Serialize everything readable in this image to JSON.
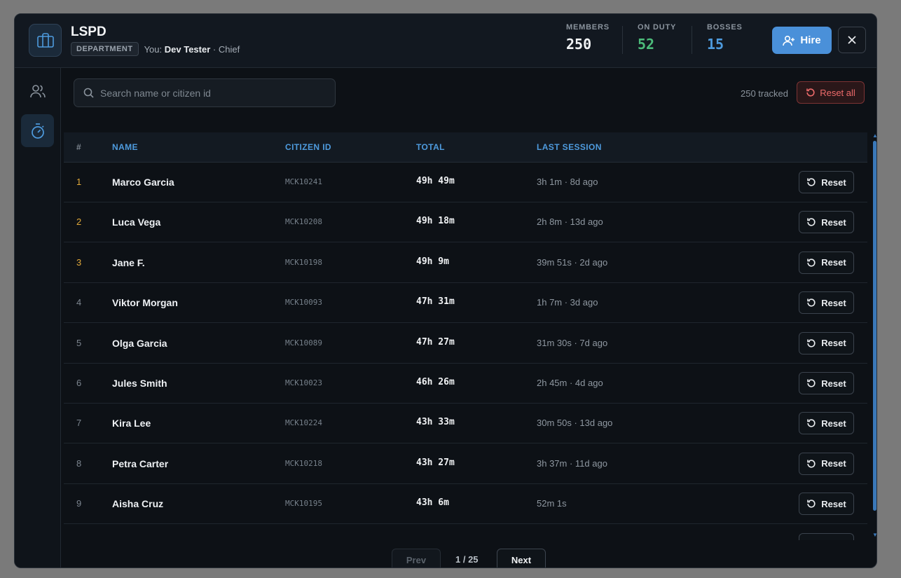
{
  "header": {
    "title": "LSPD",
    "badge": "DEPARTMENT",
    "you_prefix": "You:",
    "you_name": "Dev Tester",
    "you_role": "· Chief",
    "hire_label": "Hire"
  },
  "stats": {
    "members": {
      "label": "MEMBERS",
      "value": "250",
      "color": "#f1f3f5"
    },
    "on_duty": {
      "label": "ON DUTY",
      "value": "52",
      "color": "#4cbb7a"
    },
    "bosses": {
      "label": "BOSSES",
      "value": "15",
      "color": "#4e9bde"
    }
  },
  "sidebar": {
    "items": [
      {
        "icon": "users-icon",
        "active": false
      },
      {
        "icon": "stopwatch-icon",
        "active": true
      }
    ]
  },
  "toolbar": {
    "search_placeholder": "Search name or citizen id",
    "tracked": "250 tracked",
    "reset_all_label": "Reset all"
  },
  "table": {
    "columns": [
      "#",
      "NAME",
      "CITIZEN ID",
      "TOTAL",
      "LAST SESSION"
    ],
    "reset_label": "Reset",
    "rows": [
      {
        "rank": "1",
        "name": "Marco Garcia",
        "cid": "MCK10241",
        "total": "49h 49m",
        "last": "3h 1m · 8d ago"
      },
      {
        "rank": "2",
        "name": "Luca Vega",
        "cid": "MCK10208",
        "total": "49h 18m",
        "last": "2h 8m · 13d ago"
      },
      {
        "rank": "3",
        "name": "Jane F.",
        "cid": "MCK10198",
        "total": "49h 9m",
        "last": "39m 51s · 2d ago"
      },
      {
        "rank": "4",
        "name": "Viktor Morgan",
        "cid": "MCK10093",
        "total": "47h 31m",
        "last": "1h 7m · 3d ago"
      },
      {
        "rank": "5",
        "name": "Olga Garcia",
        "cid": "MCK10089",
        "total": "47h 27m",
        "last": "31m 30s · 7d ago"
      },
      {
        "rank": "6",
        "name": "Jules Smith",
        "cid": "MCK10023",
        "total": "46h 26m",
        "last": "2h 45m · 4d ago"
      },
      {
        "rank": "7",
        "name": "Kira Lee",
        "cid": "MCK10224",
        "total": "43h 33m",
        "last": "30m 50s · 13d ago"
      },
      {
        "rank": "8",
        "name": "Petra Carter",
        "cid": "MCK10218",
        "total": "43h 27m",
        "last": "3h 37m · 11d ago"
      },
      {
        "rank": "9",
        "name": "Aisha Cruz",
        "cid": "MCK10195",
        "total": "43h 6m",
        "last": "52m 1s"
      }
    ]
  },
  "pager": {
    "prev_label": "Prev",
    "page": "1 / 25",
    "next_label": "Next"
  }
}
